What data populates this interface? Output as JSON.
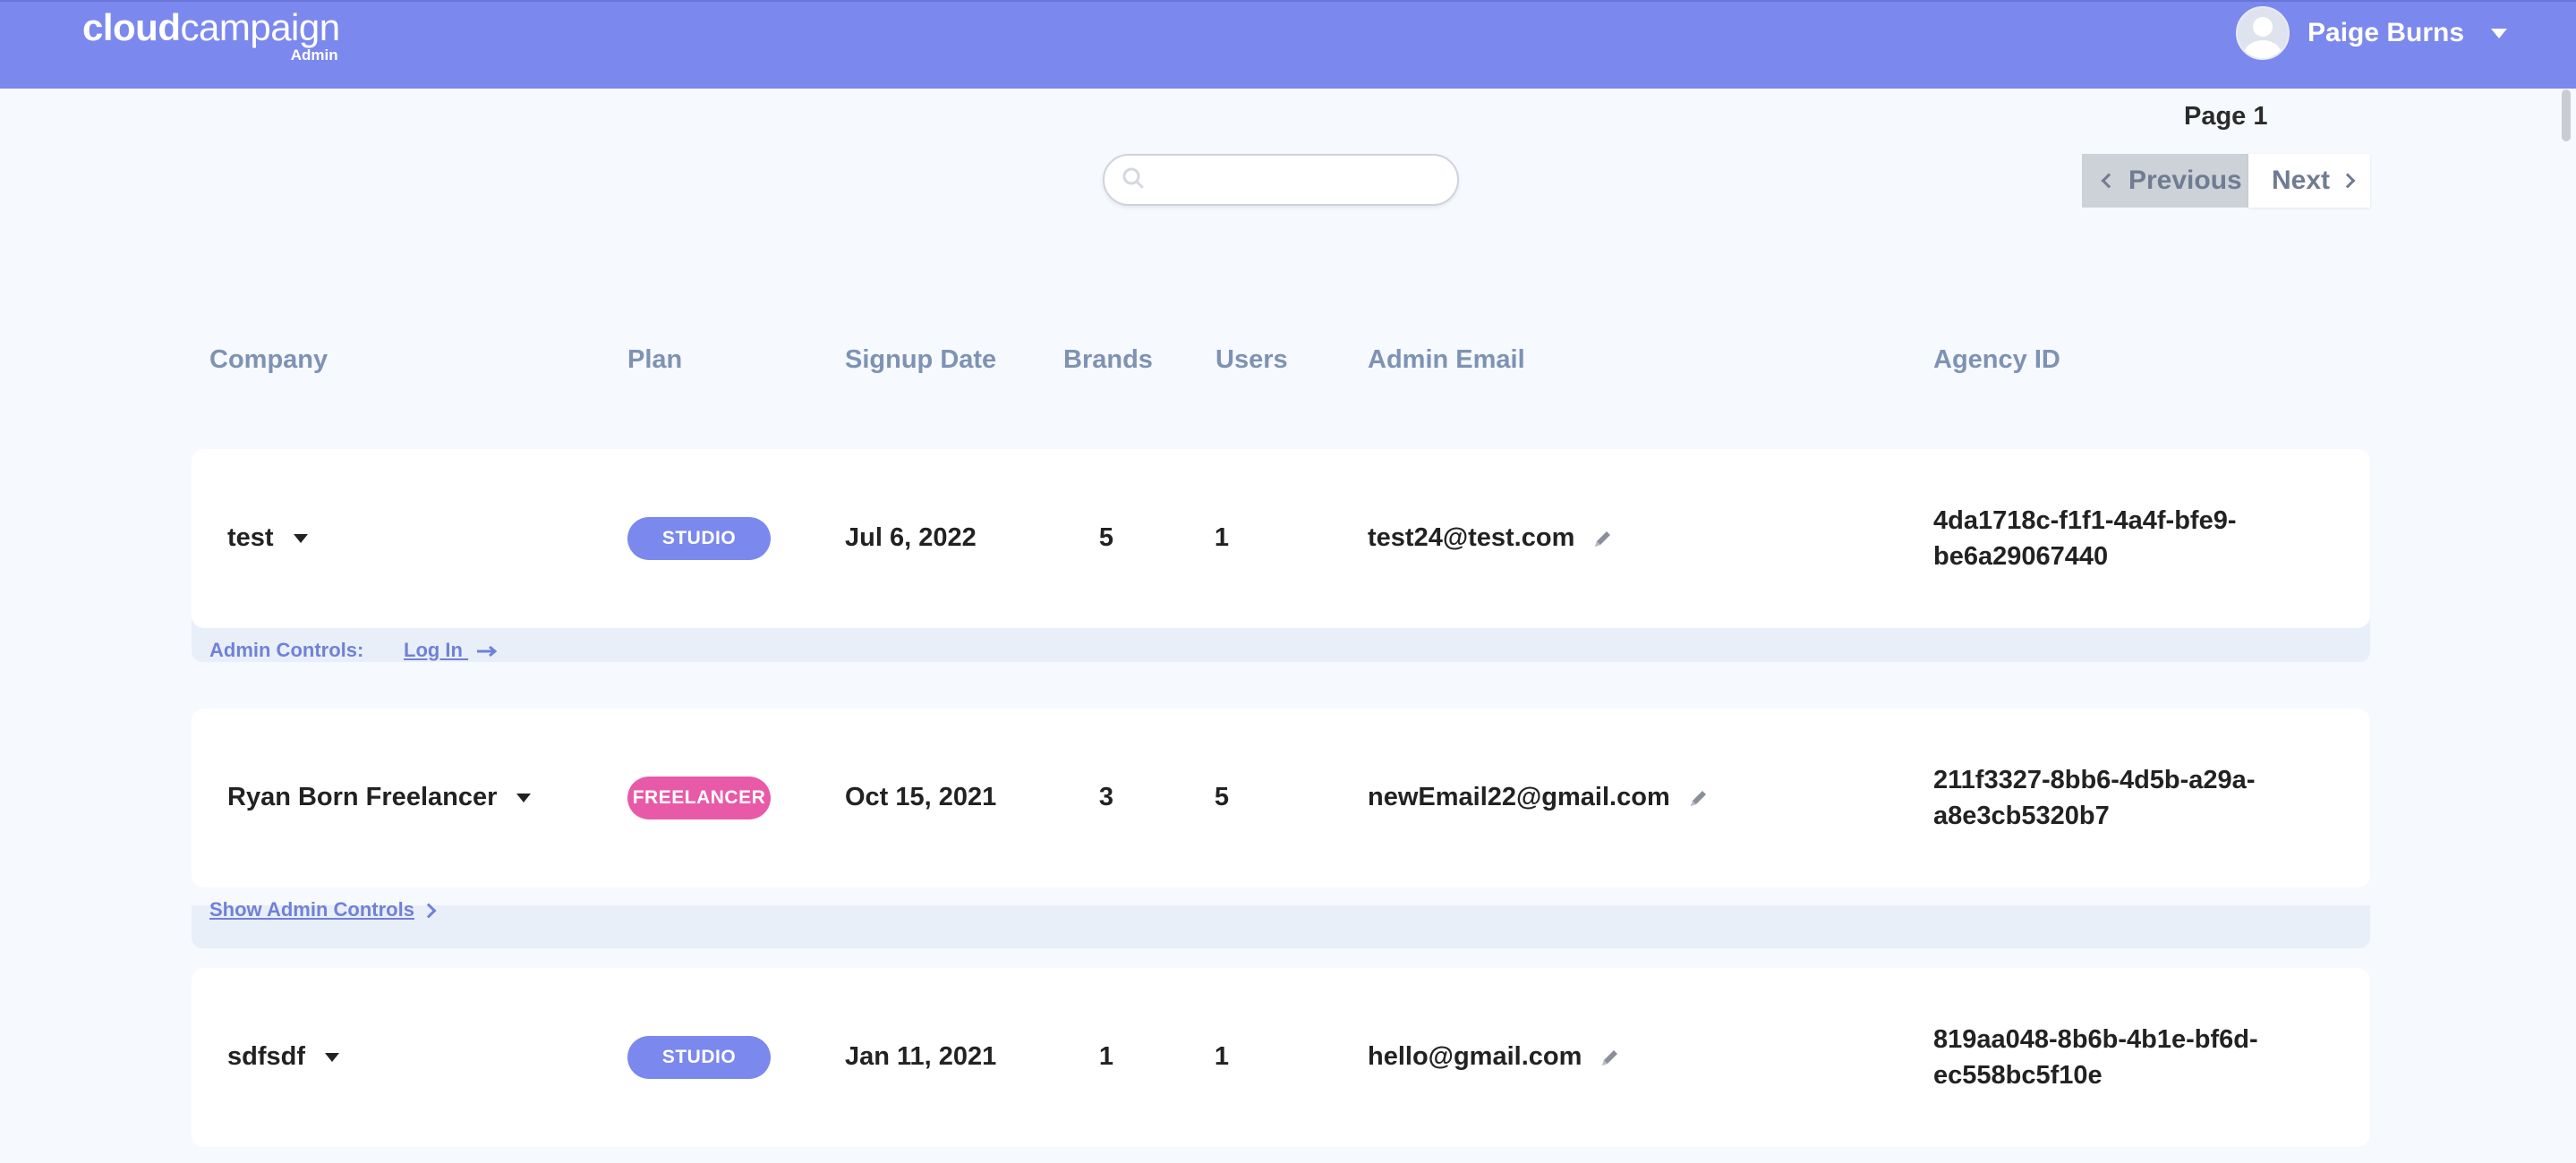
{
  "header": {
    "logo_bold": "cloud",
    "logo_light": "campaign",
    "logo_sub": "Admin",
    "user_name": "Paige Burns",
    "brand_color": "#7b88ee"
  },
  "pagination": {
    "page_label": "Page 1",
    "previous_label": "Previous",
    "next_label": "Next"
  },
  "search": {
    "placeholder": "",
    "value": ""
  },
  "table": {
    "columns": [
      "Company",
      "Plan",
      "Signup Date",
      "Brands",
      "Users",
      "Admin Email",
      "Agency ID"
    ],
    "rows": [
      {
        "company": "test",
        "plan": "STUDIO",
        "plan_color": "#7b88ee",
        "signup_date": "Jul 6, 2022",
        "brands": "5",
        "users": "1",
        "admin_email": "test24@test.com",
        "agency_id_line1": "4da1718c-f1f1-4a4f-bfe9-",
        "agency_id_line2": "be6a29067440",
        "admin_controls_label": "Admin Controls:",
        "admin_action_label": "Log In"
      },
      {
        "company": "Ryan Born Freelancer",
        "plan": "FREELANCER",
        "plan_color": "#e85aa8",
        "signup_date": "Oct 15, 2021",
        "brands": "3",
        "users": "5",
        "admin_email": "newEmail22@gmail.com",
        "agency_id_line1": "211f3327-8bb6-4d5b-a29a-",
        "agency_id_line2": "a8e3cb5320b7",
        "show_admin_controls_label": "Show Admin Controls"
      },
      {
        "company": "sdfsdf",
        "plan": "STUDIO",
        "plan_color": "#7b88ee",
        "signup_date": "Jan 11, 2021",
        "brands": "1",
        "users": "1",
        "admin_email": "hello@gmail.com",
        "agency_id_line1": "819aa048-8b6b-4b1e-bf6d-",
        "agency_id_line2": "ec558bc5f10e"
      }
    ]
  }
}
